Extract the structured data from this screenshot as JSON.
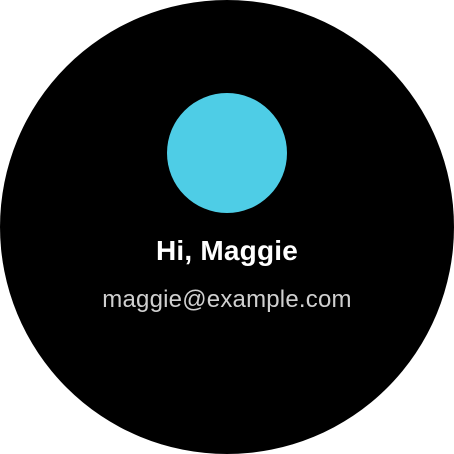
{
  "profile": {
    "greeting": "Hi, Maggie",
    "email": "maggie@example.com",
    "avatar_color": "#4ecde6"
  },
  "colors": {
    "screen_background": "#000000",
    "greeting_text": "#ffffff",
    "email_text": "#d0d0d0"
  }
}
